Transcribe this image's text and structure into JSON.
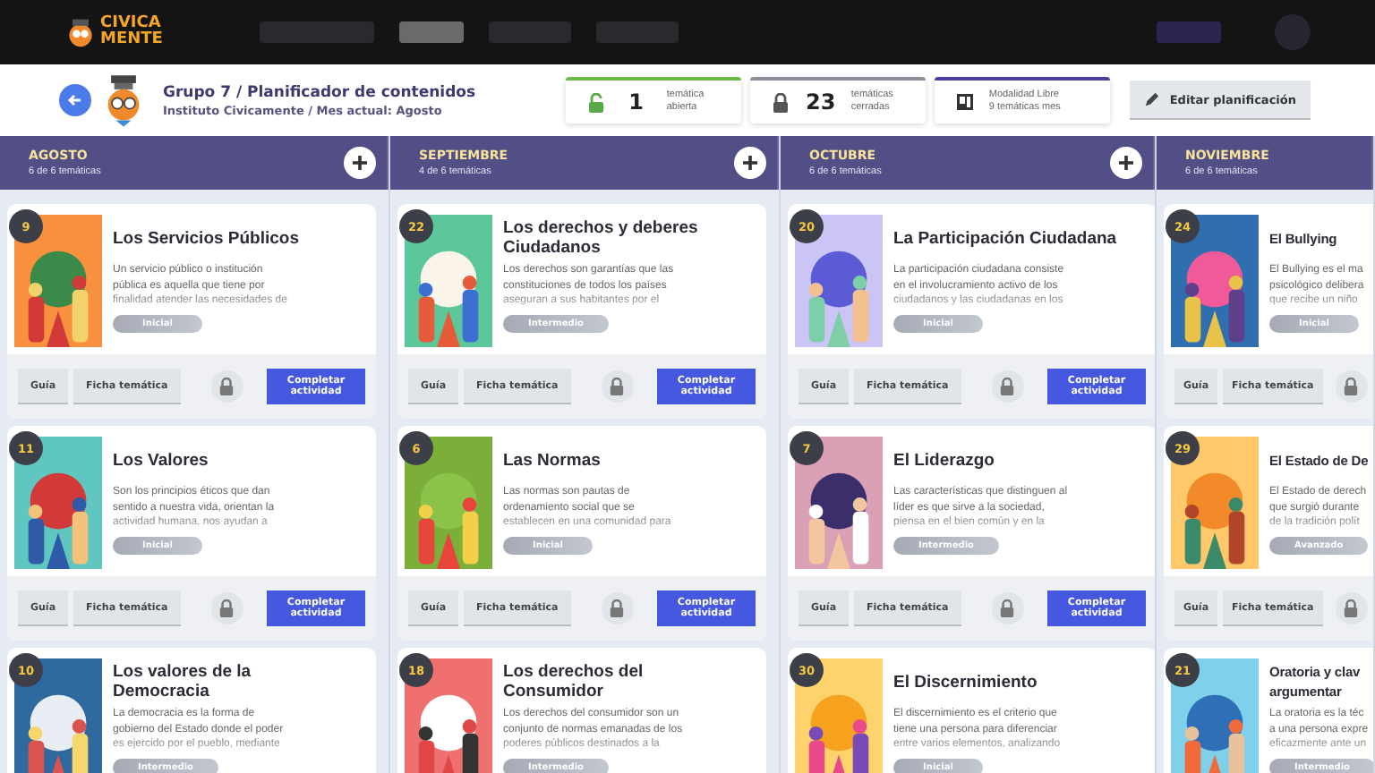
{
  "nav": {
    "logo": [
      "CIVICA",
      "MENTE"
    ]
  },
  "header": {
    "title": "Grupo 7 / Planificador de contenidos",
    "subtitle": "Instituto Civicamente / Mes actual: Agosto"
  },
  "stats": [
    {
      "kind": "open",
      "value": "1",
      "label": "temática\nabierta"
    },
    {
      "kind": "closed",
      "value": "23",
      "label": "temáticas\ncerradas"
    },
    {
      "kind": "mode",
      "label": "Modalidad Libre\n9 temáticas mes"
    }
  ],
  "edit_button": "Editar planificación",
  "months": [
    {
      "name": "AGOSTO",
      "count": "6 de 6 temáticas",
      "add": true,
      "cards": [
        {
          "number": "9",
          "title": "Los Servicios Públicos",
          "description": "Un servicio público o institución\npública es aquella que tiene por\nfinalidad atender las necesidades de",
          "level": "Inicial",
          "footer": {
            "guide": "Guía",
            "sheet": "Ficha temática",
            "complete": "Completar actividad"
          }
        },
        {
          "number": "11",
          "title": "Los Valores",
          "description": "Son los principios éticos que dan\nsentido a nuestra vida, orientan la\nactividad humana, nos ayudan a",
          "level": "Inicial",
          "footer": {
            "guide": "Guía",
            "sheet": "Ficha temática",
            "complete": "Completar actividad"
          }
        },
        {
          "number": "10",
          "title": "Los valores de la\nDemocracia",
          "description": "La democracia es la forma de\ngobierno del Estado donde el poder\nes ejercido por el pueblo, mediante",
          "level": "Intermedio"
        }
      ]
    },
    {
      "name": "SEPTIEMBRE",
      "count": "4 de 6 temáticas",
      "add": true,
      "cards": [
        {
          "number": "22",
          "title": "Los derechos y deberes\nCiudadanos",
          "description": "Los derechos son garantías que las\nconstituciones de todos los países\naseguran a sus habitantes por el",
          "level": "Intermedio",
          "footer": {
            "guide": "Guía",
            "sheet": "Ficha temática",
            "complete": "Completar actividad"
          }
        },
        {
          "number": "6",
          "title": "Las Normas",
          "description": "Las normas son pautas de\nordenamiento social que se\nestablecen en una comunidad para",
          "level": "Inicial",
          "footer": {
            "guide": "Guía",
            "sheet": "Ficha temática",
            "complete": "Completar actividad"
          }
        },
        {
          "number": "18",
          "title": "Los derechos del\nConsumidor",
          "description": "Los derechos del consumidor son un\nconjunto de normas emanadas de los\npoderes públicos destinados a la",
          "level": "Intermedio"
        }
      ]
    },
    {
      "name": "OCTUBRE",
      "count": "6 de 6 temáticas",
      "add": true,
      "cards": [
        {
          "number": "20",
          "title": "La Participación Ciudadana",
          "description": "La participación ciudadana consiste\nen el involucramiento activo de los\nciudadanos y las ciudadanas en los",
          "level": "Inicial",
          "footer": {
            "guide": "Guía",
            "sheet": "Ficha temática",
            "complete": "Completar actividad"
          }
        },
        {
          "number": "7",
          "title": "El Liderazgo",
          "description": "Las características que distinguen al\nlíder es que sirve a la sociedad,\npiensa en el bien común y en la",
          "level": "Intermedio",
          "footer": {
            "guide": "Guía",
            "sheet": "Ficha temática",
            "complete": "Completar actividad"
          }
        },
        {
          "number": "30",
          "title": "El Discernimiento",
          "description": "El discernimiento es el criterio que\ntiene una persona para diferenciar\nentre varios elementos, analizando",
          "level": "Inicial"
        }
      ]
    },
    {
      "name": "NOVIEMBRE",
      "count": "6 de 6 temáticas",
      "add": false,
      "cards": [
        {
          "number": "24",
          "title": "El Bullying",
          "description": "El Bullying es el ma\npsicológico delibera\nque recibe un niño",
          "level": "Inicial",
          "footer": {
            "guide": "Guía",
            "sheet": "Ficha temática"
          }
        },
        {
          "number": "29",
          "title": "El Estado de De",
          "description": "El Estado de derech\nque surgió durante\nde la tradición polít",
          "level": "Avanzado",
          "footer": {
            "guide": "Guía",
            "sheet": "Ficha temática"
          }
        },
        {
          "number": "21",
          "title": "Oratoria y clav\nargumentar",
          "description": "La oratoria es la téc\na una persona expre\neficazmente ante un",
          "level": "Intermedio"
        }
      ]
    }
  ]
}
